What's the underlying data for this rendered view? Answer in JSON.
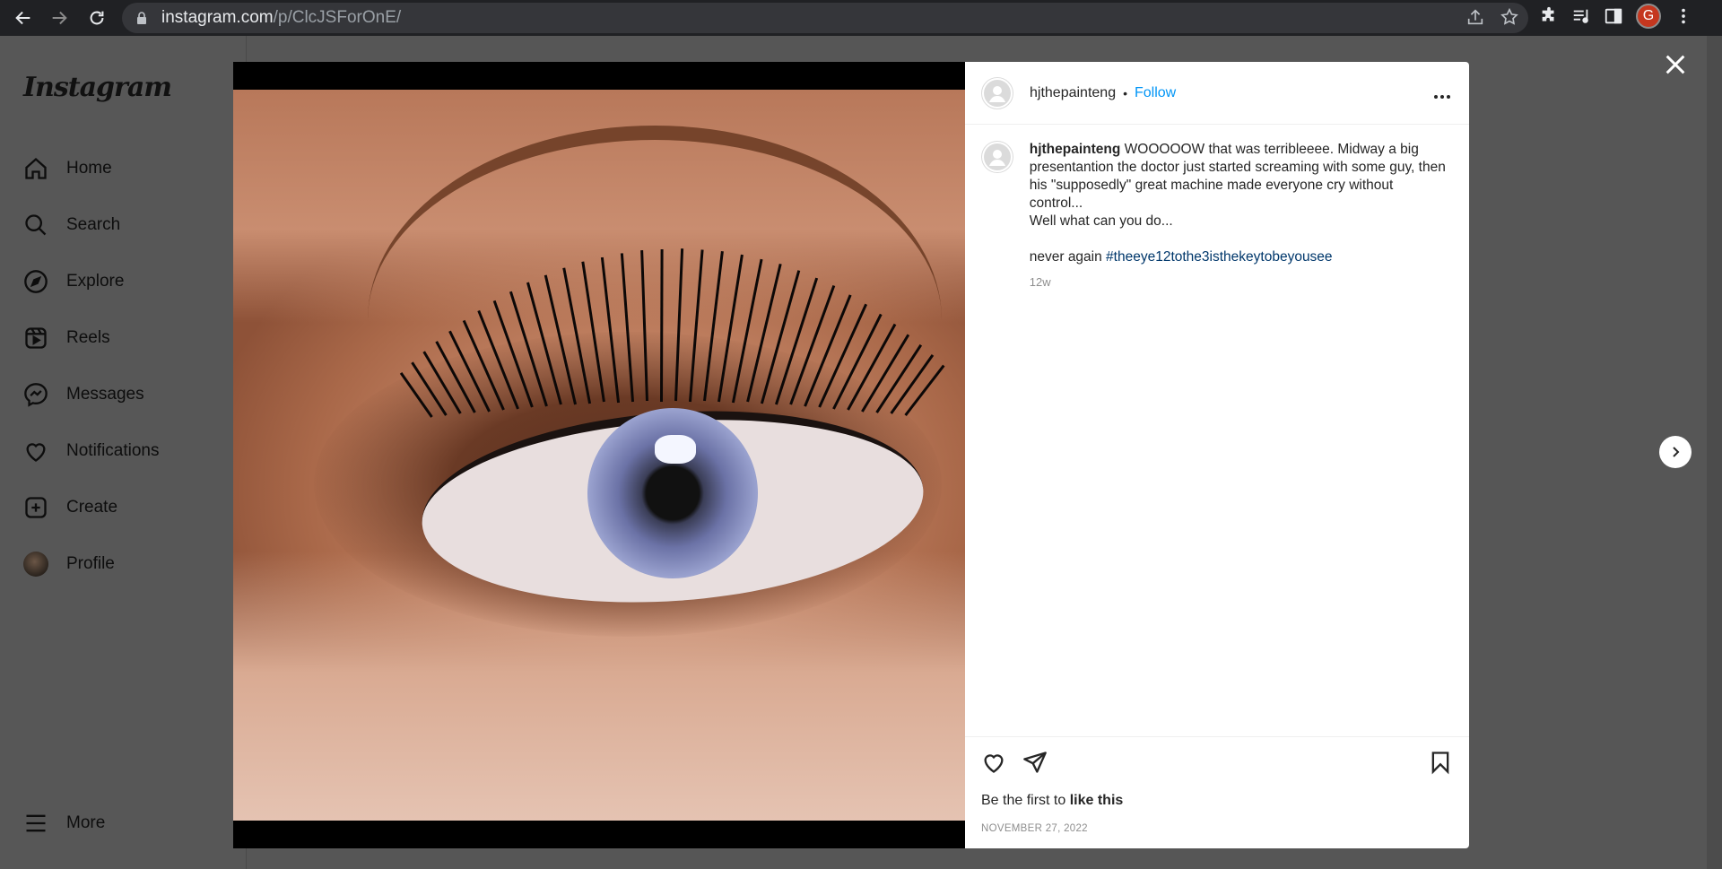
{
  "browser": {
    "url_host": "instagram.com",
    "url_path": "/p/ClcJSForOnE/",
    "profile_initial": "G"
  },
  "sidebar": {
    "logo": "Instagram",
    "items": [
      {
        "label": "Home",
        "icon": "home-icon"
      },
      {
        "label": "Search",
        "icon": "search-icon"
      },
      {
        "label": "Explore",
        "icon": "compass-icon"
      },
      {
        "label": "Reels",
        "icon": "reels-icon"
      },
      {
        "label": "Messages",
        "icon": "messenger-icon"
      },
      {
        "label": "Notifications",
        "icon": "heart-icon"
      },
      {
        "label": "Create",
        "icon": "plus-square-icon"
      },
      {
        "label": "Profile",
        "icon": "avatar"
      }
    ],
    "more_label": "More"
  },
  "post": {
    "username": "hjthepainteng",
    "separator": "•",
    "follow_label": "Follow",
    "caption_user": "hjthepainteng",
    "caption_line1": " WOOOOOW that was terribleeee. Midway a big presentantion the doctor just started screaming with some guy, then his \"supposedly\" great machine made everyone cry without control...",
    "caption_line2": "Well what can you do...",
    "caption_line3": "never again ",
    "hashtag": "#theeye12tothe3isthekeytobeyousee",
    "time_ago": "12w",
    "likes_prefix": "Be the first to ",
    "likes_bold": "like this",
    "date": "NOVEMBER 27, 2022"
  }
}
